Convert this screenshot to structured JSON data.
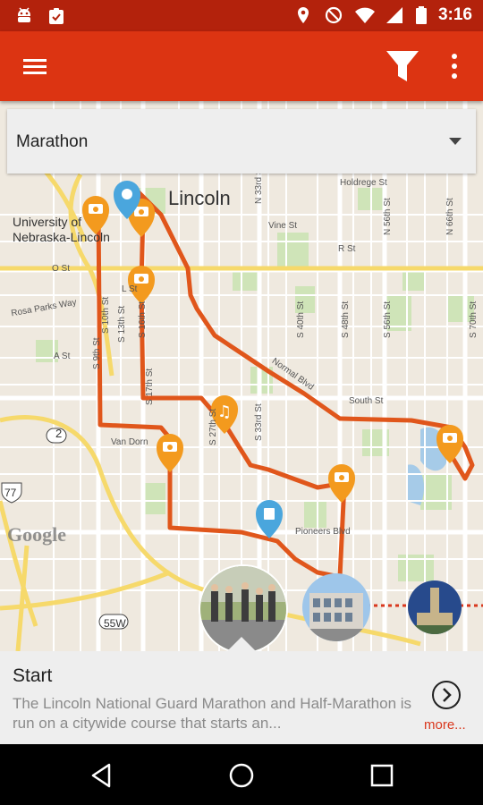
{
  "status_bar": {
    "time": "3:16",
    "left_icons": [
      "android-icon",
      "clipboard-check-icon"
    ],
    "right_icons": [
      "location-icon",
      "blocked-icon",
      "wifi-icon",
      "signal-icon",
      "battery-icon"
    ]
  },
  "app_bar": {
    "color": "#dc3412",
    "icons": [
      "menu-icon",
      "filter-icon",
      "more-vert-icon"
    ]
  },
  "filter_dropdown": {
    "selected": "Marathon"
  },
  "map": {
    "labels": {
      "city": "Lincoln",
      "university": "University of\nNebraska-Lincoln",
      "holdrege": "Holdrege St",
      "vine": "Vine St",
      "r_st": "R St",
      "o_st": "O St",
      "l_st": "L St",
      "rosa_parks": "Rosa Parks Way",
      "a_st": "A St",
      "south_st": "South St",
      "van_dorn": "Van Dorn",
      "normal_blvd": "Normal Blvd",
      "pioneers_blvd": "Pioneers Blvd",
      "s9": "S 9th St",
      "s10": "S 10th St",
      "s13": "S 13th St",
      "s16": "S 16th St",
      "s17": "S 17th St",
      "s27": "S 27th St",
      "s33": "S 33rd St",
      "n33": "N 33rd St",
      "s40": "S 40th St",
      "s48": "S 48th St",
      "s56": "S 56th St",
      "n56": "N 56th St",
      "n66": "N 66th St",
      "s70": "S 70th St",
      "hwy2": "2",
      "hwy77": "77",
      "hwy55w": "55W",
      "google": "Google"
    }
  },
  "card": {
    "title": "Start",
    "description": "The Lincoln National Guard Marathon and Half-Marathon is run on a citywide course that starts an...",
    "more": "more..."
  },
  "nav_bar": {
    "icons": [
      "back-icon",
      "home-icon",
      "recents-icon"
    ]
  }
}
